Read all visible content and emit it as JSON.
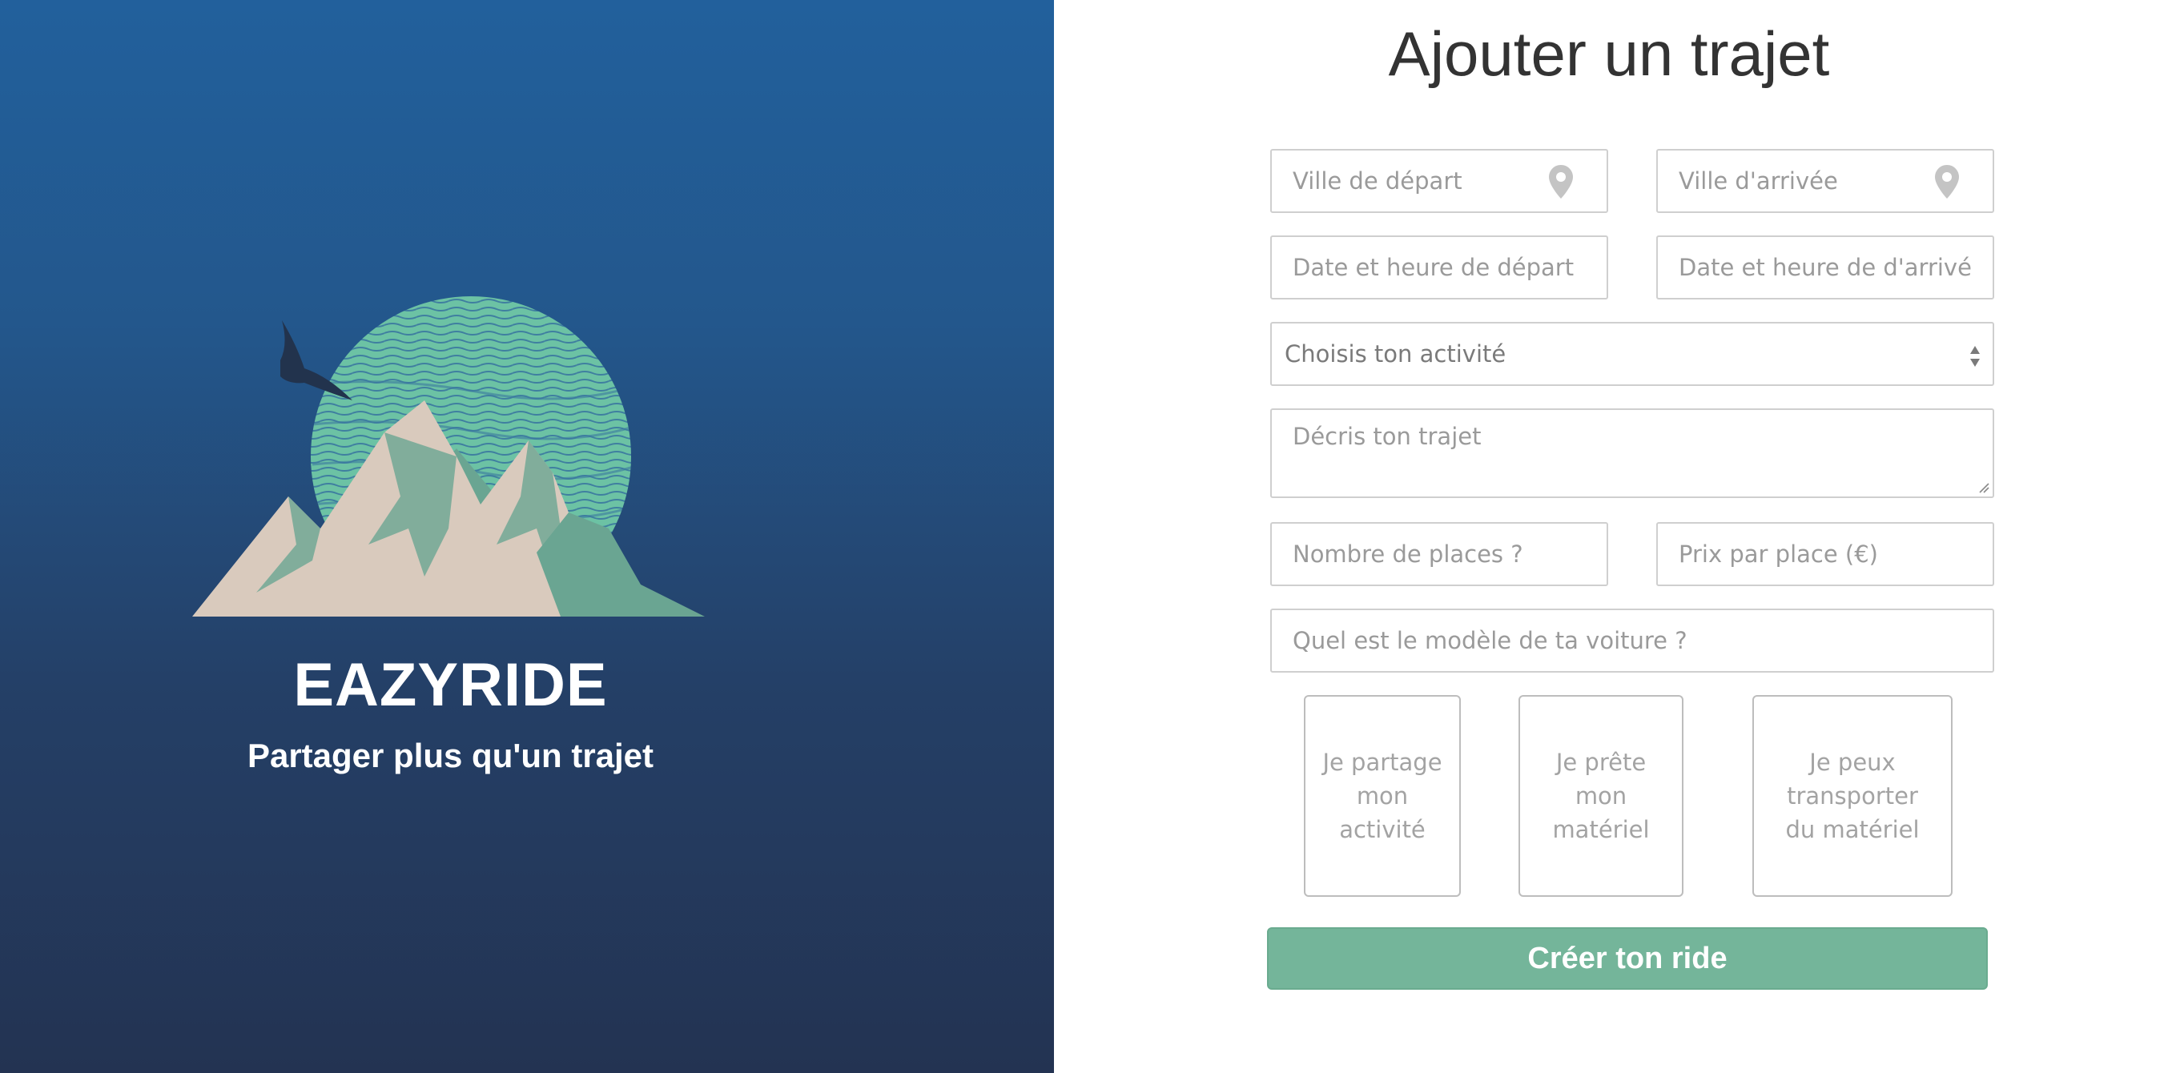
{
  "brand": {
    "name": "EAZYRIDE",
    "tagline": "Partager plus qu'un trajet"
  },
  "form": {
    "title": "Ajouter un trajet",
    "departure_city": {
      "placeholder": "Ville de départ",
      "icon": "location-pin-icon"
    },
    "arrival_city": {
      "placeholder": "Ville d'arrivée",
      "icon": "location-pin-icon"
    },
    "departure_datetime": {
      "placeholder": "Date et heure de départ"
    },
    "arrival_datetime": {
      "placeholder": "Date et heure de d'arrivé"
    },
    "activity_select": {
      "selected": "Choisis ton activité"
    },
    "description": {
      "placeholder": "Décris ton trajet"
    },
    "seats": {
      "placeholder": "Nombre de places ?"
    },
    "price": {
      "placeholder": "Prix par place (€)"
    },
    "car_model": {
      "placeholder": "Quel est le modèle de ta voiture ?"
    },
    "options": [
      {
        "label": "Je partage mon activité"
      },
      {
        "label": "Je prête mon matériel"
      },
      {
        "label": "Je peux transporter du matériel"
      }
    ],
    "submit_label": "Créer ton ride"
  },
  "colors": {
    "panel_gradient_top": "#22609c",
    "panel_gradient_bottom": "#233352",
    "accent_green": "#74b59a",
    "field_border": "#cfcfcf",
    "placeholder_text": "#9a9a9a"
  }
}
